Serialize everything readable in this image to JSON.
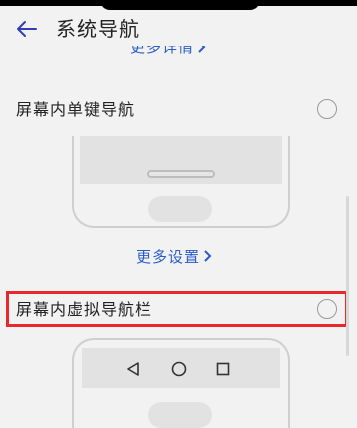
{
  "header": {
    "title": "系统导航",
    "back_icon": "back-arrow-icon"
  },
  "links": {
    "more_details": "更多详情",
    "more_settings": "更多设置"
  },
  "options": [
    {
      "label": "屏幕内单键导航",
      "selected": false
    },
    {
      "label": "屏幕内虚拟导航栏",
      "selected": false,
      "highlighted": true
    }
  ],
  "nav_keys": [
    "back-triangle-icon",
    "home-circle-icon",
    "recents-square-icon"
  ],
  "colors": {
    "accent": "#2a5cc9",
    "highlight_border": "#e8282b",
    "background": "#f2f2f2"
  }
}
